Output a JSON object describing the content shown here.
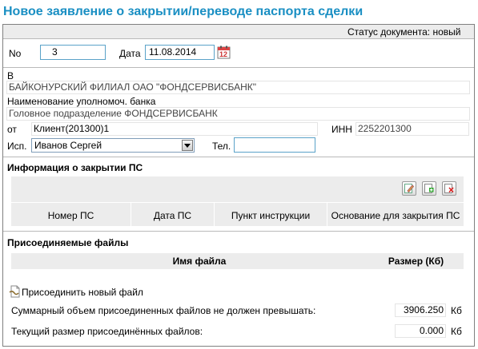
{
  "page": {
    "title": "Новое заявление о закрытии/переводе паспорта сделки",
    "status_label": "Статус документа:",
    "status_value": "новый"
  },
  "doc": {
    "no_label": "No",
    "no_value": "3",
    "date_label": "Дата",
    "date_value": "11.08.2014",
    "calendar_icon_text": "12"
  },
  "bank": {
    "to_label": "В",
    "bank_name": "БАЙКОНУРСКИЙ ФИЛИАЛ ОАО \"ФОНДСЕРВИСБАНК\"",
    "authorized_label": "Наименование уполномоч. банка",
    "authorized_value": "Головное подразделение ФОНДСЕРВИСБАНК"
  },
  "client": {
    "from_label": "от",
    "from_value": "Клиент(201300)1",
    "inn_label": "ИНН",
    "inn_value": "2252201300",
    "executor_label": "Исп.",
    "executor_value": "Иванов Сергей",
    "phone_label": "Тел.",
    "phone_value": ""
  },
  "closing_info": {
    "section_title": "Информация о закрытии ПС",
    "columns": [
      "Номер ПС",
      "Дата ПС",
      "Пункт инструкции",
      "Основание для закрытия ПС"
    ]
  },
  "files": {
    "section_title": "Присоединяемые файлы",
    "col_name": "Имя файла",
    "col_size": "Размер (Кб)",
    "attach_label": "Присоединить новый файл",
    "max_label": "Суммарный объем присоединенных файлов не должен превышать:",
    "max_value": "3906.250",
    "max_unit": "Кб",
    "current_label": "Текущий размер присоединённых файлов:",
    "current_value": "0.000",
    "current_unit": "Кб"
  },
  "colors": {
    "title": "#1a8fc3",
    "input_border": "#5aa2c8",
    "header_bg": "#ececec"
  }
}
